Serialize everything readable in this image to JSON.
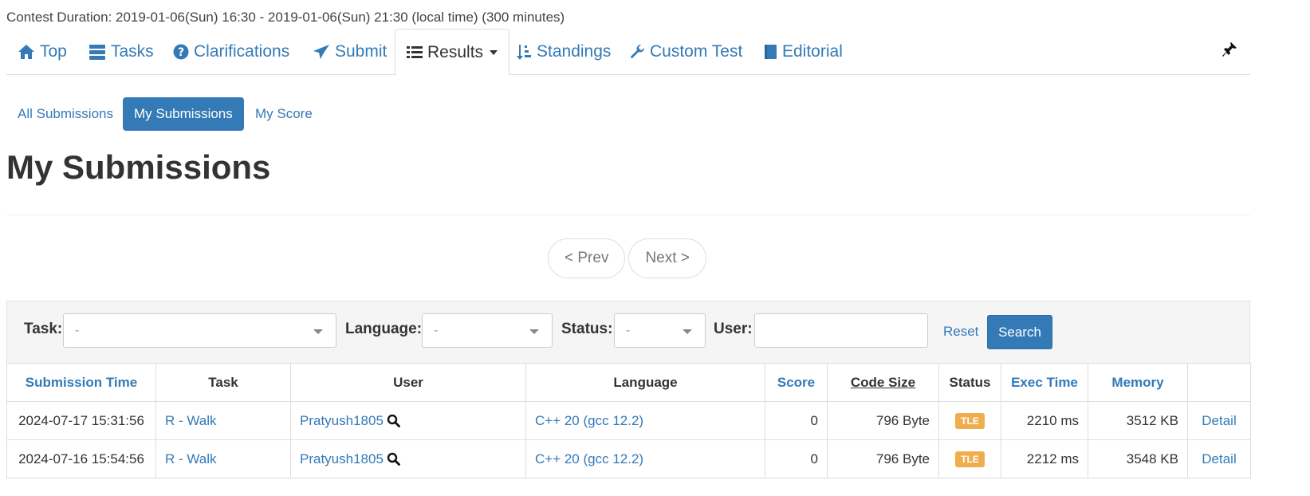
{
  "contest": {
    "duration": "Contest Duration: 2019-01-06(Sun) 16:30 - 2019-01-06(Sun) 21:30 (local time) (300 minutes)"
  },
  "nav": {
    "top": "Top",
    "tasks": "Tasks",
    "clarifications": "Clarifications",
    "submit": "Submit",
    "results": "Results",
    "standings": "Standings",
    "custom_test": "Custom Test",
    "editorial": "Editorial"
  },
  "subnav": {
    "all": "All Submissions",
    "mine": "My Submissions",
    "score": "My Score"
  },
  "page_title": "My Submissions",
  "pager": {
    "prev": "< Prev",
    "next": "Next >"
  },
  "filter": {
    "task_label": "Task:",
    "task_value": "-",
    "language_label": "Language:",
    "language_value": "-",
    "status_label": "Status:",
    "status_value": "-",
    "user_label": "User:",
    "user_value": "",
    "reset": "Reset",
    "search": "Search"
  },
  "table": {
    "headers": {
      "time": "Submission Time",
      "task": "Task",
      "user": "User",
      "language": "Language",
      "score": "Score",
      "code_size": "Code Size",
      "status": "Status",
      "exec_time": "Exec Time",
      "memory": "Memory"
    },
    "rows": [
      {
        "time": "2024-07-17 15:31:56",
        "task": "R - Walk",
        "user": "Pratyush1805",
        "language": "C++ 20 (gcc 12.2)",
        "score": "0",
        "code_size": "796 Byte",
        "status": "TLE",
        "exec_time": "2210 ms",
        "memory": "3512 KB",
        "detail": "Detail"
      },
      {
        "time": "2024-07-16 15:54:56",
        "task": "R - Walk",
        "user": "Pratyush1805",
        "language": "C++ 20 (gcc 12.2)",
        "score": "0",
        "code_size": "796 Byte",
        "status": "TLE",
        "exec_time": "2212 ms",
        "memory": "3548 KB",
        "detail": "Detail"
      }
    ]
  },
  "colors": {
    "link": "#337ab7",
    "tle_badge": "#f0ad4e"
  }
}
